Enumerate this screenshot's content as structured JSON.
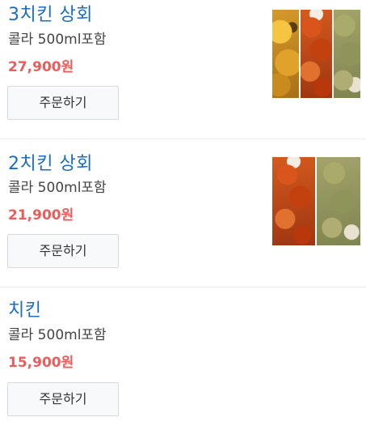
{
  "menu": {
    "items": [
      {
        "name": "3치킨 상회",
        "description": "콜라 500ml포함",
        "price": "27,900원",
        "order_label": "주문하기",
        "image": "three-chicken-combo-photo"
      },
      {
        "name": "2치킨 상회",
        "description": "콜라 500ml포함",
        "price": "21,900원",
        "order_label": "주문하기",
        "image": "two-chicken-combo-photo"
      },
      {
        "name": "치킨",
        "description": "콜라 500ml포함",
        "price": "15,900원",
        "order_label": "주문하기"
      }
    ]
  },
  "colors": {
    "name": "#1a6cc7",
    "price": "#ef5b5b",
    "button_bg": "#f8f9fb",
    "divider": "#ececec"
  }
}
